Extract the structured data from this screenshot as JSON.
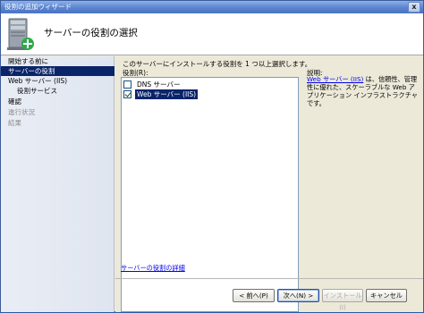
{
  "window": {
    "title": "役割の追加ウィザード",
    "close_label": "x"
  },
  "header": {
    "title": "サーバーの役割の選択",
    "icon": "server-add-icon"
  },
  "sidebar": {
    "steps": [
      {
        "label": "開始する前に",
        "state": "normal"
      },
      {
        "label": "サーバーの役割",
        "state": "active"
      },
      {
        "label": "Web サーバー (IIS)",
        "state": "normal"
      },
      {
        "label": "役割サービス",
        "state": "normal"
      },
      {
        "label": "確認",
        "state": "normal"
      },
      {
        "label": "進行状況",
        "state": "disabled"
      },
      {
        "label": "結果",
        "state": "disabled"
      }
    ]
  },
  "main": {
    "instruction": "このサーバーにインストールする役割を 1 つ以上選択します。",
    "roles_label": "役割(R):",
    "roles": [
      {
        "label": "DNS サーバー",
        "checked": false,
        "selected": false
      },
      {
        "label": "Web サーバー (IIS)",
        "checked": true,
        "selected": true
      }
    ],
    "description_title": "説明:",
    "description_link": "Web サーバー (IIS)",
    "description_text": " は、信頼性、管理性に優れた、スケーラブルな Web アプリケーション インフラストラクチャです。",
    "more_link": "サーバーの役割の詳細"
  },
  "buttons": {
    "back": "< 前へ(P)",
    "next": "次へ(N) >",
    "install": "インストール(I)",
    "cancel": "キャンセル"
  },
  "colors": {
    "selection": "#0a246a",
    "titlebar": "#5a84d0",
    "link": "#0000ee"
  }
}
